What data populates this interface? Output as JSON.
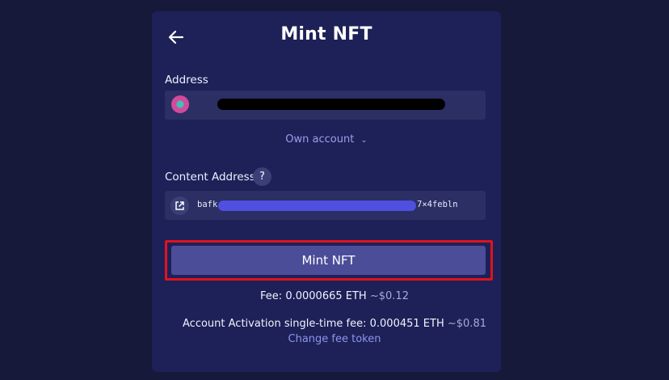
{
  "header": {
    "title": "Mint NFT",
    "back_icon": "arrow-left-icon"
  },
  "address": {
    "label": "Address",
    "account_selector": "Own account"
  },
  "content_address": {
    "label": "Content Address",
    "help_glyph": "?",
    "cid_prefix": "bafk",
    "cid_suffix": "7×4febln"
  },
  "actions": {
    "mint_label": "Mint NFT",
    "change_fee_token": "Change fee token"
  },
  "fees": {
    "fee_label": "Fee:",
    "fee_amount": "0.0000665",
    "fee_token": "ETH",
    "fee_usd": "~$0.12",
    "activation_label": "Account Activation single-time fee:",
    "activation_amount": "0.000451",
    "activation_token": "ETH",
    "activation_usd": "~$0.81"
  },
  "colors": {
    "background": "#161939",
    "panel": "#1d2157",
    "accent": "#9a9ff0",
    "button": "#4c4d99",
    "highlight": "#e0121f"
  }
}
